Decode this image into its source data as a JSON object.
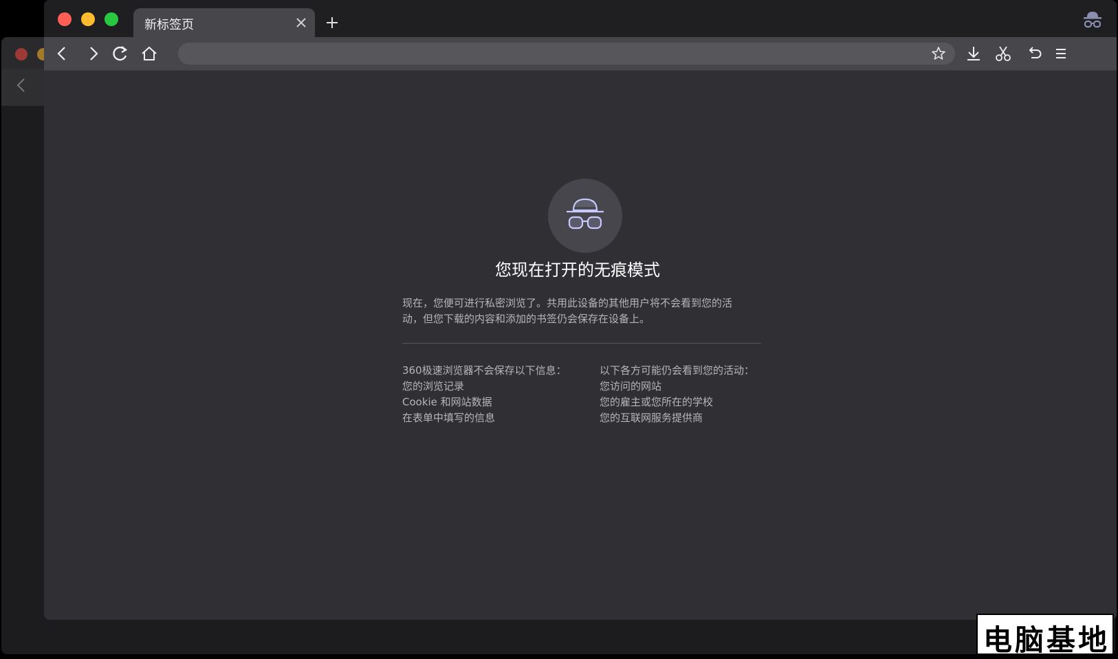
{
  "tab": {
    "title": "新标签页"
  },
  "omnibox": {
    "value": "",
    "placeholder": ""
  },
  "incognito": {
    "headline": "您现在打开的无痕模式",
    "description_lines": [
      "现在，您便可进行私密浏览了。共用此设备的其他用户将不会看到您的活",
      "动，但您下载的内容和添加的书签仍会保存在设备上。"
    ],
    "not_saved": {
      "title": "360极速浏览器不会保存以下信息：",
      "items": [
        "您的浏览记录",
        "Cookie 和网站数据",
        "在表单中填写的信息"
      ]
    },
    "may_see": {
      "title": "以下各方可能仍会看到您的活动：",
      "items": [
        "您访问的网站",
        "您的雇主或您所在的学校",
        "您的互联网服务提供商"
      ]
    }
  },
  "watermark": "电脑基地",
  "colors": {
    "accent_icon": "#c9c9ff",
    "traffic_red": "#ff5f57",
    "traffic_yellow": "#febc2e",
    "traffic_green": "#28c840"
  },
  "icons": [
    "back-icon",
    "forward-icon",
    "reload-icon",
    "home-icon",
    "star-icon",
    "download-icon",
    "scissors-icon",
    "undo-icon",
    "menu-icon",
    "incognito-icon",
    "close-icon",
    "plus-icon"
  ]
}
